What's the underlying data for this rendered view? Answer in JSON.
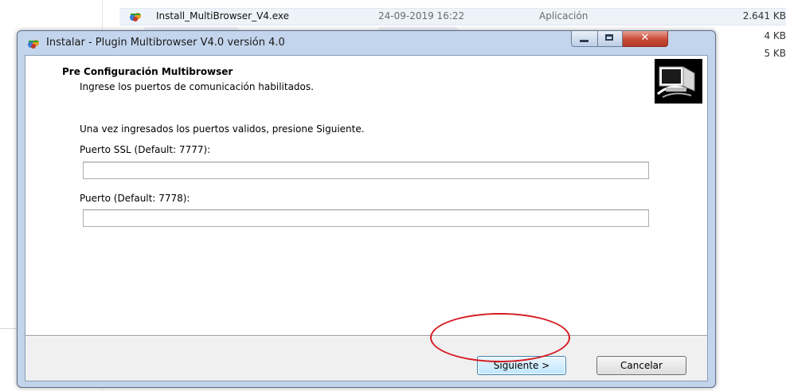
{
  "explorer": {
    "file": {
      "name": "Install_MultiBrowser_V4.exe",
      "date": "24-09-2019 16:22",
      "type": "Aplicación",
      "size": "2.641 KB"
    },
    "other_sizes": [
      "4 KB",
      "5 KB"
    ]
  },
  "dialog": {
    "title": "Instalar - Plugin Multibrowser V4.0 versión 4.0",
    "header": {
      "title": "Pre Configuración Multibrowser",
      "subtitle": "Ingrese los puertos de comunicación habilitados."
    },
    "instruction": "Una vez ingresados los puertos validos, presione Siguiente.",
    "ssl_port": {
      "label": "Puerto SSL (Default: 7777):",
      "value": ""
    },
    "port": {
      "label": "Puerto (Default: 7778):",
      "value": ""
    },
    "buttons": {
      "next": "Siguiente >",
      "cancel": "Cancelar"
    }
  },
  "colors": {
    "frame": "#c3d5ec",
    "close_button": "#c94a35",
    "highlight_ring": "#d6191f"
  }
}
